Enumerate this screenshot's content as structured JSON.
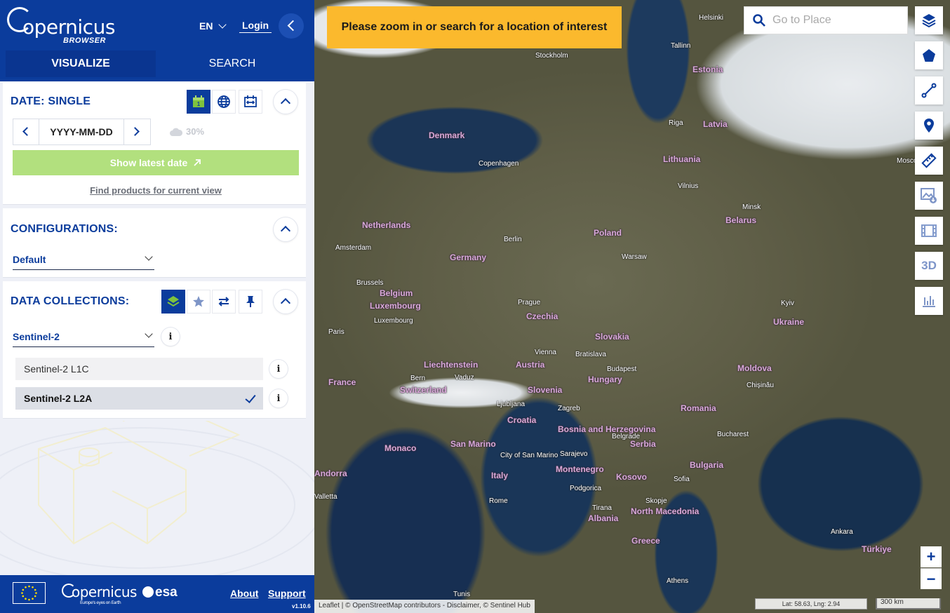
{
  "header": {
    "logo_text": "opernicus",
    "logo_sub": "BROWSER",
    "language": "EN",
    "login": "Login"
  },
  "tabs": [
    {
      "label": "VISUALIZE",
      "active": true
    },
    {
      "label": "SEARCH",
      "active": false
    }
  ],
  "date_panel": {
    "title": "DATE: SINGLE",
    "date_placeholder": "YYYY-MM-DD",
    "cloud_coverage": "30%",
    "show_latest": "Show latest date",
    "find_products": "Find products for current view"
  },
  "config_panel": {
    "title": "CONFIGURATIONS:",
    "selected": "Default"
  },
  "collections_panel": {
    "title": "DATA COLLECTIONS:",
    "selected": "Sentinel-2",
    "items": [
      {
        "label": "Sentinel-2 L1C",
        "selected": false
      },
      {
        "label": "Sentinel-2 L2A",
        "selected": true
      }
    ]
  },
  "footer": {
    "copernicus": "opernicus",
    "copernicus_tagline": "Europe's eyes on Earth",
    "esa": "esa",
    "about": "About",
    "support": "Support",
    "version": "v1.10.6"
  },
  "map": {
    "banner": "Please zoom in or search for a location of interest",
    "search_placeholder": "Go to Place",
    "zoom_in": "+",
    "zoom_out": "−",
    "tool_3d": "3D",
    "attribution": "Leaflet | © OpenStreetMap contributors - Disclaimer, © Sentinel Hub",
    "coordinates": "Lat: 58.63, Lng: 2.94",
    "scale": "300 km",
    "countries": [
      "Estonia",
      "Latvia",
      "Lithuania",
      "Denmark",
      "Belarus",
      "Netherlands",
      "Poland",
      "Germany",
      "Belgium",
      "Luxembourg",
      "Czechia",
      "Slovakia",
      "Ukraine",
      "Austria",
      "Liechtenstein",
      "Hungary",
      "Moldova",
      "France",
      "Switzerland",
      "Slovenia",
      "Romania",
      "Croatia",
      "Bosnia and Herzegovina",
      "Serbia",
      "San Marino",
      "Monaco",
      "Montenegro",
      "Kosovo",
      "Bulgaria",
      "Italy",
      "Albania",
      "North Macedonia",
      "Greece",
      "Türkiye",
      "Andorra"
    ],
    "cities": [
      "Helsinki",
      "Tallinn",
      "Stockholm",
      "Riga",
      "Moscow",
      "Copenhagen",
      "Vilnius",
      "Minsk",
      "Amsterdam",
      "Berlin",
      "Warsaw",
      "Brussels",
      "Prague",
      "Kyiv",
      "Luxembourg",
      "Paris",
      "Vienna",
      "Bratislava",
      "Budapest",
      "Bern",
      "Vaduz",
      "Chișinău",
      "Ljubljana",
      "Zagreb",
      "Bucharest",
      "City of San Marino",
      "Sarajevo",
      "Belgrade",
      "Podgorica",
      "Sofia",
      "Rome",
      "Skopje",
      "Tirana",
      "Ankara",
      "Athens",
      "Tunis",
      "Valletta"
    ]
  },
  "colors": {
    "brand": "#0b3c9c",
    "banner": "#fbb92d",
    "latest_button": "#b2e07e"
  }
}
